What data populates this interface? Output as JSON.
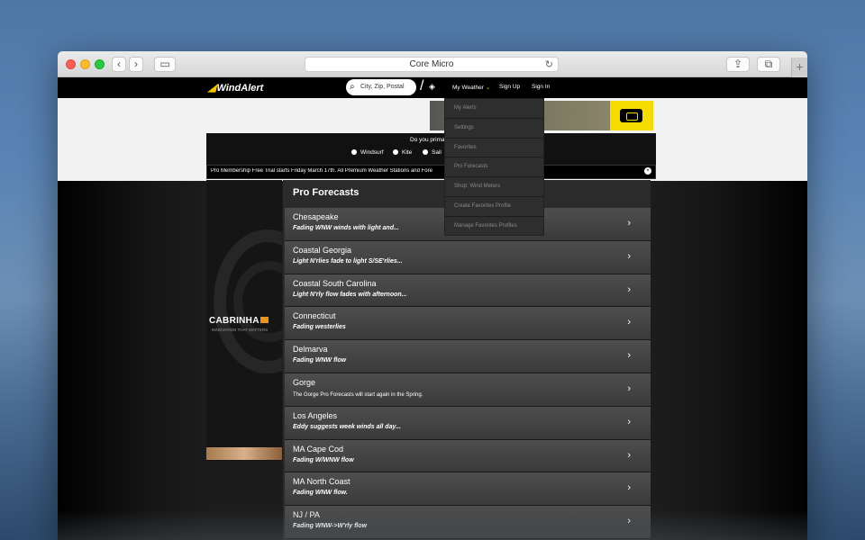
{
  "browser": {
    "address_text": "Core Micro",
    "back_glyph": "‹",
    "forward_glyph": "›",
    "sidebar_glyph": "▭",
    "reload_glyph": "↻",
    "share_glyph": "⇪",
    "tabs_glyph": "⧉",
    "newtab_glyph": "+"
  },
  "site": {
    "logo_mark": "◢",
    "logo_text": "WindAlert",
    "search_placeholder": "City, Zip, Postal",
    "search_glyph": "⌕",
    "slash_glyph": "/",
    "compass_glyph": "◈",
    "nav": {
      "my_weather": "My Weather",
      "my_weather_chevron": "⌄",
      "sign_up": "Sign Up",
      "sign_in": "Sign In"
    }
  },
  "survey": {
    "question": "Do you prima",
    "options": [
      "Windsurf",
      "Kite",
      "Sail"
    ]
  },
  "promo": {
    "text": "Pro Membership Free Trial starts Friday March 17th. All Premium Weather Stations and Fore",
    "close_glyph": "×"
  },
  "side_ad": {
    "brand": "CABRINHA",
    "tagline": "INNOVATION THAT MATTERS"
  },
  "dropdown": {
    "items": [
      "My Alerts",
      "Settings",
      "Favorites",
      "Pro Forecasts",
      "Shop: Wind Meters",
      "Create Favorites Profile",
      "Manage Favorites Profiles"
    ]
  },
  "pro_forecasts": {
    "title": "Pro Forecasts",
    "chevron": "›",
    "items": [
      {
        "name": "Chesapeake",
        "summary": "Fading WNW winds with light and..."
      },
      {
        "name": "Coastal Georgia",
        "summary": "Light N'rlies fade to light S/SE'rlies..."
      },
      {
        "name": "Coastal South Carolina",
        "summary": "Light N'rly flow fades with afternoon..."
      },
      {
        "name": "Connecticut",
        "summary": "Fading westerlies"
      },
      {
        "name": "Delmarva",
        "summary": "Fading WNW flow"
      },
      {
        "name": "Gorge",
        "summary": "The Gorge Pro Forecasts will start again in the Spring."
      },
      {
        "name": "Los Angeles",
        "summary": "Eddy suggests week winds all day..."
      },
      {
        "name": "MA Cape Cod",
        "summary": "Fading W/WNW flow"
      },
      {
        "name": "MA North Coast",
        "summary": "Fading WNW flow."
      },
      {
        "name": "NJ / PA",
        "summary": "Fading WNW->W'rly flow"
      }
    ]
  }
}
